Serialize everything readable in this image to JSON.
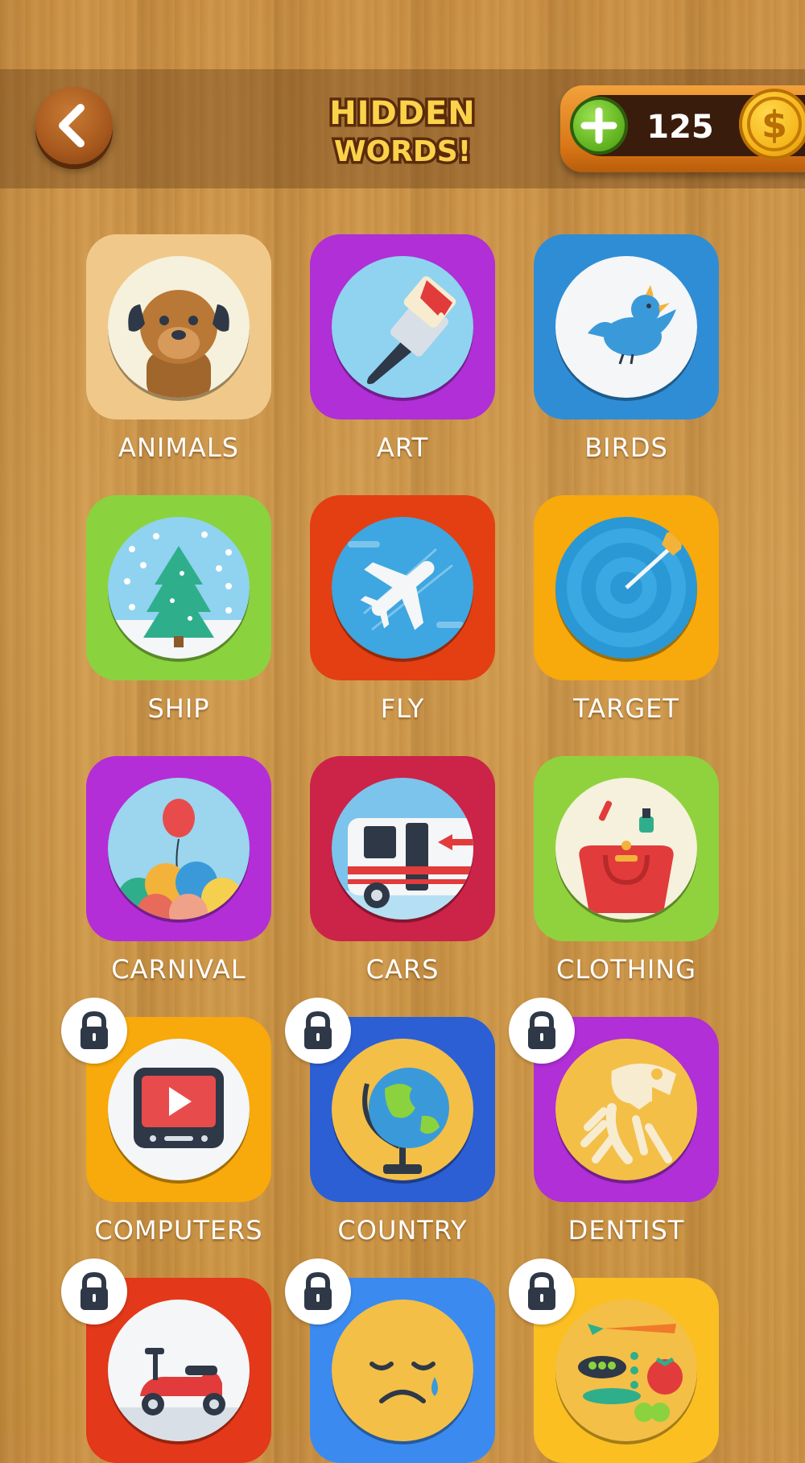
{
  "header": {
    "back_icon": "chevron-left-icon",
    "logo_text_line1": "HIDDEN",
    "logo_text_line2": "WORDS!",
    "add_coins_icon": "plus-icon",
    "coins": "125",
    "coin_icon": "dollar-coin-icon"
  },
  "categories": [
    {
      "label": "ANIMALS",
      "icon": "dog-icon",
      "bg": "#f0c98a",
      "locked": false
    },
    {
      "label": "ART",
      "icon": "paintbrush-icon",
      "bg": "#b02fd6",
      "locked": false
    },
    {
      "label": "BIRDS",
      "icon": "bird-icon",
      "bg": "#2f8dd6",
      "locked": false
    },
    {
      "label": "SHIP",
      "icon": "snow-globe-tree-icon",
      "bg": "#8bd23f",
      "locked": false
    },
    {
      "label": "FLY",
      "icon": "airplane-icon",
      "bg": "#e33f12",
      "locked": false
    },
    {
      "label": "TARGET",
      "icon": "target-arrow-icon",
      "bg": "#f8a90b",
      "locked": false
    },
    {
      "label": "CARNIVAL",
      "icon": "balloons-icon",
      "bg": "#b42ed8",
      "locked": false
    },
    {
      "label": "CARS",
      "icon": "ambulance-icon",
      "bg": "#cc2348",
      "locked": false
    },
    {
      "label": "CLOTHING",
      "icon": "handbag-icon",
      "bg": "#8fd23e",
      "locked": false
    },
    {
      "label": "COMPUTERS",
      "icon": "tv-play-icon",
      "bg": "#f8a90b",
      "locked": true
    },
    {
      "label": "COUNTRY",
      "icon": "globe-icon",
      "bg": "#2c5fd4",
      "locked": true
    },
    {
      "label": "DENTIST",
      "icon": "dinosaur-skeleton-icon",
      "bg": "#b02fd6",
      "locked": true
    },
    {
      "label": "",
      "icon": "scooter-icon",
      "bg": "#e3381a",
      "locked": true
    },
    {
      "label": "",
      "icon": "sad-face-icon",
      "bg": "#3b8af0",
      "locked": true
    },
    {
      "label": "",
      "icon": "vegetables-icon",
      "bg": "#fbbf22",
      "locked": true
    }
  ],
  "lock_icon": "lock-icon"
}
